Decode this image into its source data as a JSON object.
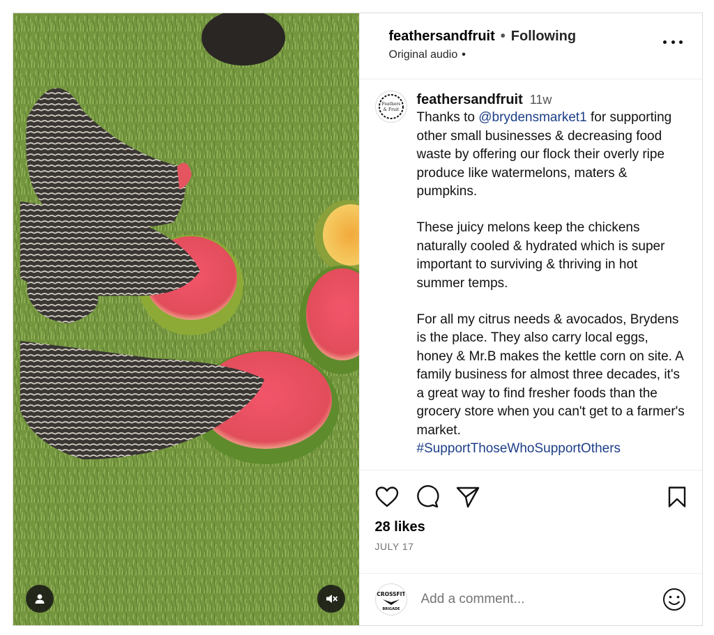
{
  "header": {
    "username": "feathersandfruit",
    "separator": "•",
    "follow_status": "Following",
    "audio": "Original audio",
    "audio_separator": "•",
    "more_icon": "more-horizontal-icon"
  },
  "caption": {
    "username": "feathersandfruit",
    "time_ago": "11w",
    "avatar_text_line1": "Feathers",
    "avatar_text_line2": "& Fruit",
    "p1_lead": "Thanks to ",
    "p1_mention": "@brydensmarket1",
    "p1_rest": " for supporting other small businesses & decreasing food waste by offering our flock their overly ripe produce like watermelons, maters & pumpkins.",
    "p2": "These juicy melons keep the chickens naturally cooled & hydrated which is super important to surviving & thriving in hot summer temps.",
    "p3": "For all my citrus needs & avocados, Brydens is the place. They also carry local eggs, honey & Mr.B makes the kettle corn on site. A family business for almost three decades, it's a great way to find fresher foods than the grocery store when you can't get to a farmer's market.",
    "hashtag": "#SupportThoseWhoSupportOthers"
  },
  "actions": {
    "like_icon": "heart-icon",
    "comment_icon": "comment-icon",
    "share_icon": "send-icon",
    "save_icon": "bookmark-icon"
  },
  "likes": "28 likes",
  "date": "JULY 17",
  "comment": {
    "placeholder": "Add a comment...",
    "avatar_text_top": "CROSSFIT",
    "avatar_text_bottom": "BRIGADE",
    "emoji_icon": "emoji-smile-icon"
  },
  "media": {
    "user_tag_icon": "person-icon",
    "mute_icon": "speaker-muted-icon"
  }
}
